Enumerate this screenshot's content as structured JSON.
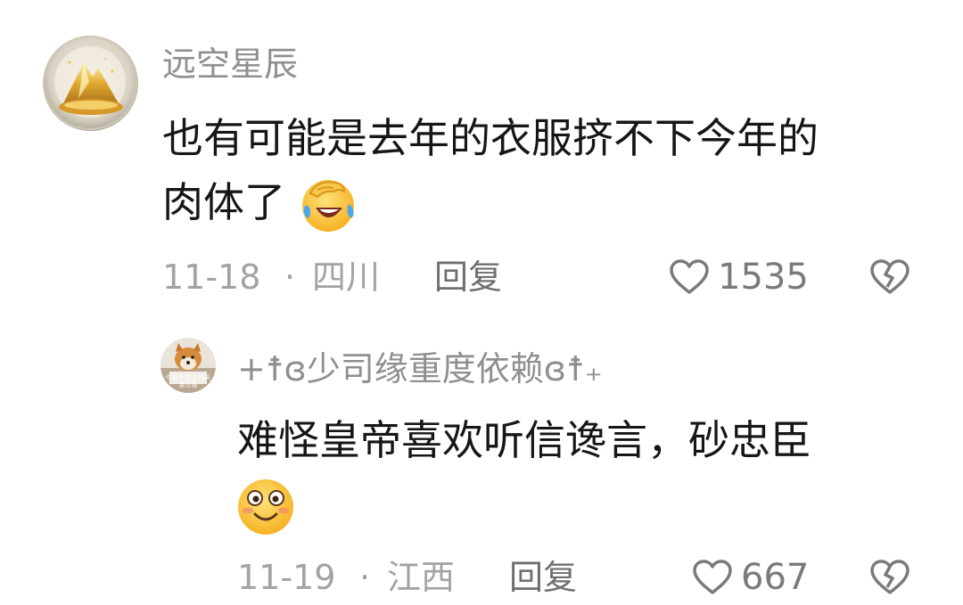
{
  "comments": [
    {
      "username": "远空星辰",
      "text_line1": "也有可能是去年的衣服挤不下今年的",
      "text_line2": "肉体了",
      "emoji": "facepalm-laughing-emoji",
      "date": "11-18",
      "separator": "·",
      "location": "四川",
      "reply_label": "回复",
      "likes": "1535",
      "like_icon": "heart-outline-icon",
      "dislike_icon": "broken-heart-icon"
    },
    {
      "username": "+☨ɞ少司缘重度依赖ɞ☨₊",
      "avatar_text": "今天不学习 明天变垃圾",
      "text_line1": "难怪皇帝喜欢听信谗言，砂忠臣",
      "emoji": "smiling-face-emoji",
      "date": "11-19",
      "separator": "·",
      "location": "江西",
      "reply_label": "回复",
      "likes": "667",
      "like_icon": "heart-outline-icon",
      "dislike_icon": "broken-heart-icon"
    }
  ]
}
